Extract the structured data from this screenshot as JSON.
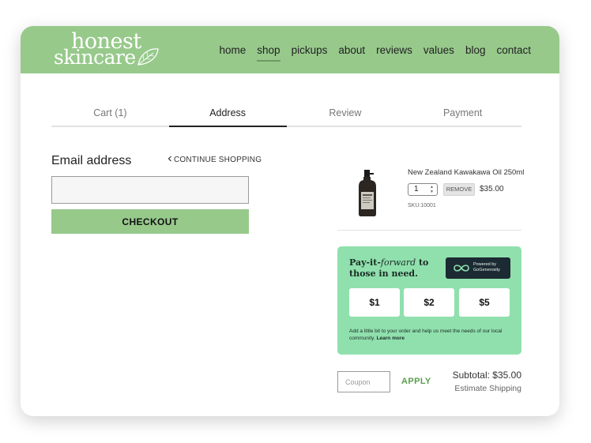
{
  "logo": {
    "line1": "honest",
    "line2": "skincare"
  },
  "nav": {
    "items": [
      "home",
      "shop",
      "pickups",
      "about",
      "reviews",
      "values",
      "blog",
      "contact"
    ],
    "active": "shop"
  },
  "steps": [
    "Cart (1)",
    "Address",
    "Review",
    "Payment"
  ],
  "active_step": "Address",
  "email_form": {
    "label": "Email address",
    "continue_shopping": "CONTINUE SHOPPING",
    "email_value": "",
    "checkout_label": "CHECKOUT"
  },
  "cart_item": {
    "name": "New Zealand Kawakawa Oil 250ml",
    "quantity": "1",
    "remove_label": "REMOVE",
    "price": "$35.00",
    "sku": "SKU:10001"
  },
  "pay_forward": {
    "title_part1": "Pay-it-",
    "title_em": "forward",
    "title_part2": " to those in need.",
    "powered_line1": "Powered by",
    "powered_line2": "GoGenerosity",
    "amounts": [
      "$1",
      "$2",
      "$5"
    ],
    "description": "Add a little bit to your order and help us meet the needs of our local community. ",
    "learn_more": "Learn more"
  },
  "coupon": {
    "placeholder": "Coupon",
    "apply_label": "APPLY"
  },
  "totals": {
    "subtotal": "Subtotal: $35.00",
    "shipping": "Estimate Shipping"
  },
  "colors": {
    "header": "#97c98b",
    "pay_forward_bg": "#90e0ad",
    "apply": "#5a9e4d",
    "badge_bg": "#1c2a33"
  },
  "icons": [
    "leaf-icon",
    "chevron-left-icon",
    "product-bottle-icon",
    "stepper-arrows-icon",
    "infinity-icon"
  ]
}
